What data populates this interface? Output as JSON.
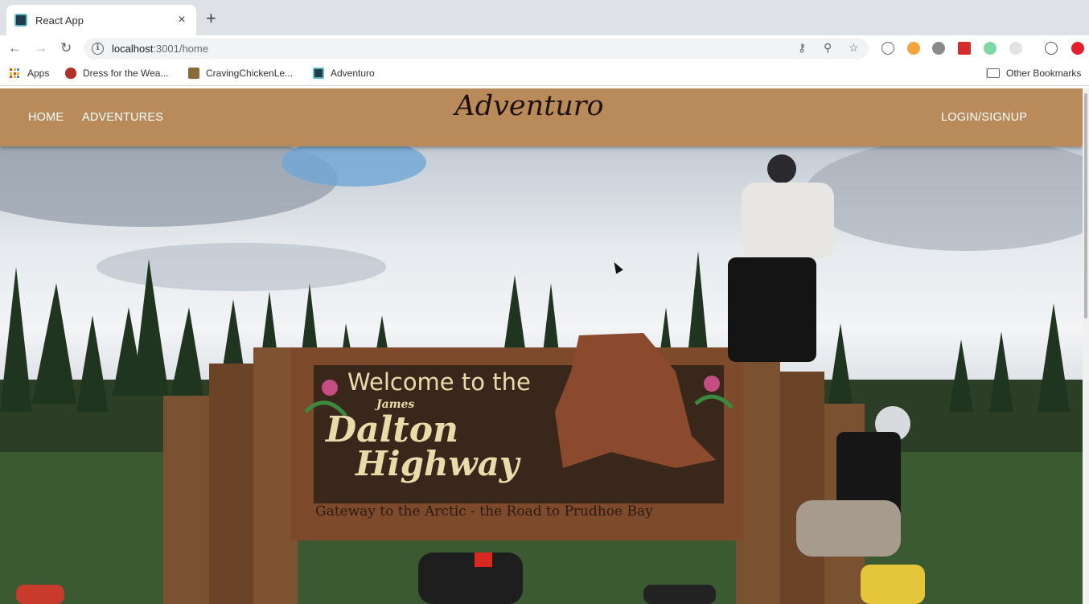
{
  "browser": {
    "tab": {
      "title": "React App",
      "close": "×"
    },
    "new_tab": "+",
    "address": {
      "host": "localhost",
      "path": ":3001/home"
    },
    "bookmarks": [
      {
        "label": "Apps"
      },
      {
        "label": "Dress for the Wea..."
      },
      {
        "label": "CravingChickenLe..."
      },
      {
        "label": "Adventuro"
      }
    ],
    "other_bookmarks": "Other Bookmarks"
  },
  "appbar": {
    "nav": [
      "HOME",
      "ADVENTURES"
    ],
    "brand": "Adventuro",
    "login": "LOGIN/SIGNUP",
    "color": "#b98b5a"
  },
  "hero": {
    "sign": {
      "line1": "Welcome to the",
      "line2": "James",
      "line3": "Dalton",
      "line4": "Highway",
      "line5": "Gateway to the Arctic - the Road to Prudhoe Bay"
    }
  }
}
